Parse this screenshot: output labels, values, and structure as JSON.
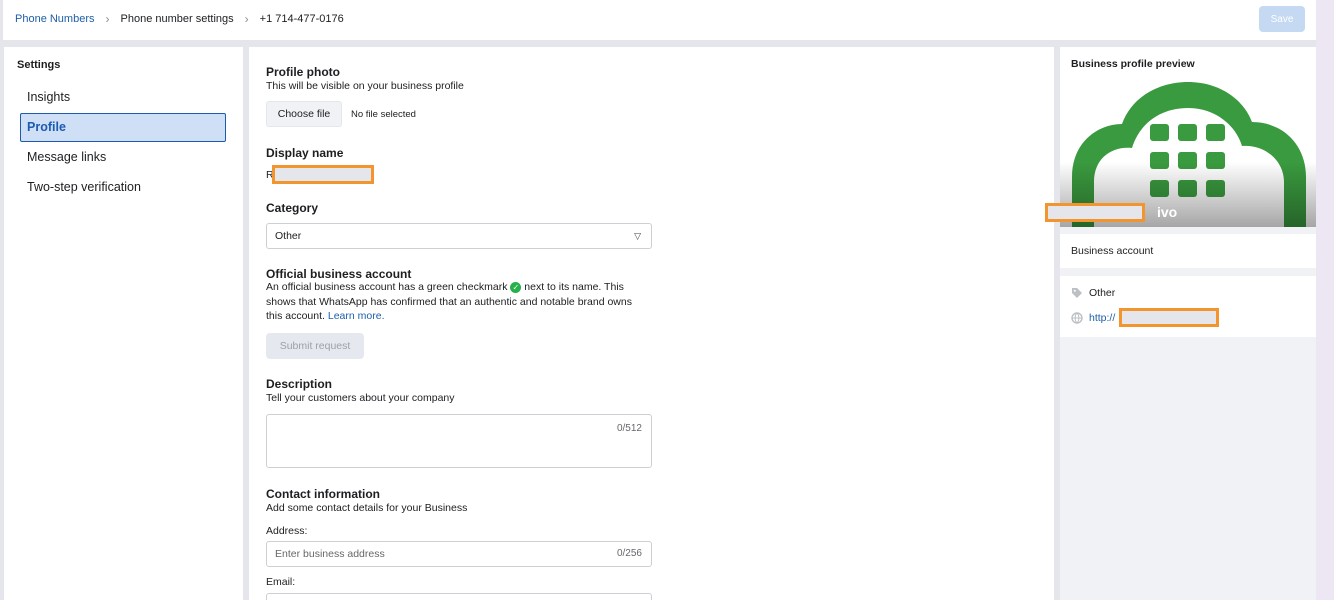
{
  "breadcrumb": {
    "items": [
      "Phone Numbers",
      "Phone number settings",
      "+1 714-477-0176"
    ]
  },
  "header": {
    "save_label": "Save"
  },
  "sidebar": {
    "title": "Settings",
    "items": [
      {
        "label": "Insights"
      },
      {
        "label": "Profile"
      },
      {
        "label": "Message links"
      },
      {
        "label": "Two-step verification"
      }
    ],
    "active": "Profile"
  },
  "main": {
    "profile_photo": {
      "heading": "Profile photo",
      "subtitle": "This will be visible on your business profile",
      "choose_file_label": "Choose file",
      "file_status": "No file selected"
    },
    "display_name": {
      "heading": "Display name",
      "value_prefix": "R"
    },
    "category": {
      "heading": "Category",
      "value": "Other"
    },
    "official": {
      "heading": "Official business account",
      "text_before": "An official business account has a green checkmark",
      "text_after": "next to its name. This shows that WhatsApp has confirmed that an authentic and notable brand owns this account.",
      "learn_more": "Learn more.",
      "submit_label": "Submit request"
    },
    "description": {
      "heading": "Description",
      "subtitle": "Tell your customers about your company",
      "counter": "0/512"
    },
    "contact": {
      "heading": "Contact information",
      "subtitle": "Add some contact details for your Business",
      "address_label": "Address:",
      "address_placeholder": "Enter business address",
      "address_counter": "0/256",
      "email_label": "Email:"
    }
  },
  "preview": {
    "title": "Business profile preview",
    "name_suffix": "ivo",
    "account_type": "Business account",
    "category": "Other",
    "url_prefix": "http://",
    "url_suffix": "/"
  },
  "colors": {
    "accent": "#1c5bb0",
    "link": "#1d5fa8",
    "redaction_border": "#f2952f",
    "logo_green": "#3a9a3f",
    "check_green": "#25b04c"
  }
}
